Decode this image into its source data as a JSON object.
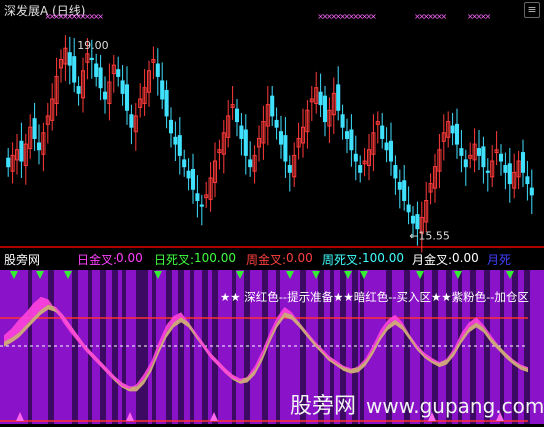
{
  "header": {
    "title": "深发展A (日线)"
  },
  "chart_data": [
    {
      "type": "candlestick",
      "title": "深发展A (日线)",
      "annotations": [
        {
          "text": "19.00",
          "value": 19.0
        },
        {
          "text": "←15.55",
          "value": 15.55
        }
      ],
      "price_range": [
        15.4,
        19.3
      ],
      "close_series": [
        16.7,
        16.9,
        17.0,
        16.8,
        17.1,
        17.4,
        17.2,
        17.0,
        17.3,
        17.6,
        17.9,
        18.3,
        18.6,
        18.8,
        18.5,
        18.2,
        18.0,
        18.4,
        18.7,
        18.6,
        18.3,
        18.1,
        17.9,
        18.2,
        18.5,
        18.3,
        18.0,
        17.7,
        17.4,
        17.6,
        17.9,
        18.1,
        18.4,
        18.6,
        18.3,
        17.9,
        17.6,
        17.3,
        17.1,
        16.9,
        16.7,
        16.5,
        16.3,
        16.1,
        16.0,
        16.2,
        16.5,
        16.8,
        17.0,
        17.3,
        17.6,
        17.8,
        17.5,
        17.2,
        16.9,
        16.7,
        16.9,
        17.2,
        17.5,
        17.8,
        17.6,
        17.4,
        17.1,
        16.8,
        16.6,
        16.9,
        17.2,
        17.4,
        17.7,
        17.9,
        18.1,
        17.8,
        17.5,
        17.7,
        18.0,
        17.7,
        17.4,
        17.2,
        17.0,
        16.8,
        16.6,
        16.8,
        17.0,
        17.3,
        17.5,
        17.2,
        17.0,
        16.8,
        16.5,
        16.3,
        16.1,
        15.9,
        15.7,
        15.6,
        15.8,
        16.1,
        16.4,
        16.7,
        17.0,
        17.3,
        17.5,
        17.3,
        17.1,
        16.9,
        16.7,
        16.9,
        17.1,
        16.9,
        16.7,
        16.6,
        16.8,
        17.0,
        16.8,
        16.6,
        16.4,
        16.6,
        16.8,
        16.6,
        16.4,
        16.2
      ],
      "top_markers": "pink x marks along top (sell signals)"
    },
    {
      "type": "area",
      "title": "股旁网",
      "legend": [
        {
          "label": "日金叉:",
          "value": "0.00",
          "color": "#ff40ff"
        },
        {
          "label": "日死叉:",
          "value": "100.00",
          "color": "#40ff40"
        },
        {
          "label": "周金叉:",
          "value": "0.00",
          "color": "#ff4040"
        },
        {
          "label": "周死叉:",
          "value": "100.00",
          "color": "#40ffff"
        },
        {
          "label": "月金叉:",
          "value": "0.00",
          "color": "#ffffff"
        },
        {
          "label": "月死",
          "value": "",
          "color": "#4040ff"
        }
      ],
      "annotation": "★★ 深红色--提示准备★★暗红色--买入区★★紫粉色--加仓区",
      "reference_lines": [
        {
          "name": "upper",
          "color": "#ff3030",
          "style": "solid"
        },
        {
          "name": "middle",
          "color": "#ffffff",
          "style": "dashed"
        }
      ],
      "series": [
        {
          "name": "pink",
          "color": "#ff44dd",
          "values": [
            60,
            65,
            72,
            78,
            85,
            90,
            88,
            80,
            70,
            62,
            55,
            48,
            42,
            36,
            30,
            25,
            20,
            18,
            22,
            30,
            40,
            55,
            68,
            75,
            78,
            70,
            60,
            50,
            42,
            36,
            30,
            26,
            24,
            28,
            36,
            48,
            62,
            74,
            82,
            78,
            70,
            62,
            55,
            48,
            42,
            38,
            35,
            33,
            36,
            42,
            52,
            64,
            72,
            76,
            70,
            60,
            50,
            44,
            40,
            38,
            42,
            50,
            62,
            70,
            74,
            68,
            60,
            52,
            46,
            40,
            36,
            34
          ]
        },
        {
          "name": "tan",
          "color": "#d2ae78",
          "values": [
            55,
            58,
            62,
            68,
            74,
            80,
            84,
            82,
            76,
            68,
            60,
            52,
            46,
            40,
            34,
            28,
            23,
            20,
            20,
            26,
            36,
            50,
            62,
            70,
            74,
            70,
            62,
            54,
            46,
            40,
            34,
            29,
            26,
            27,
            33,
            44,
            58,
            70,
            78,
            76,
            70,
            63,
            56,
            50,
            44,
            40,
            36,
            34,
            35,
            40,
            49,
            60,
            68,
            72,
            68,
            60,
            52,
            46,
            42,
            39,
            41,
            48,
            58,
            66,
            70,
            66,
            58,
            52,
            46,
            41,
            37,
            35
          ]
        }
      ],
      "buy_markers": "green triangles along top",
      "bottom_markers": "pink triangles along bottom"
    }
  ],
  "watermark": {
    "name": "股旁网",
    "url": "www.gupang.com"
  }
}
